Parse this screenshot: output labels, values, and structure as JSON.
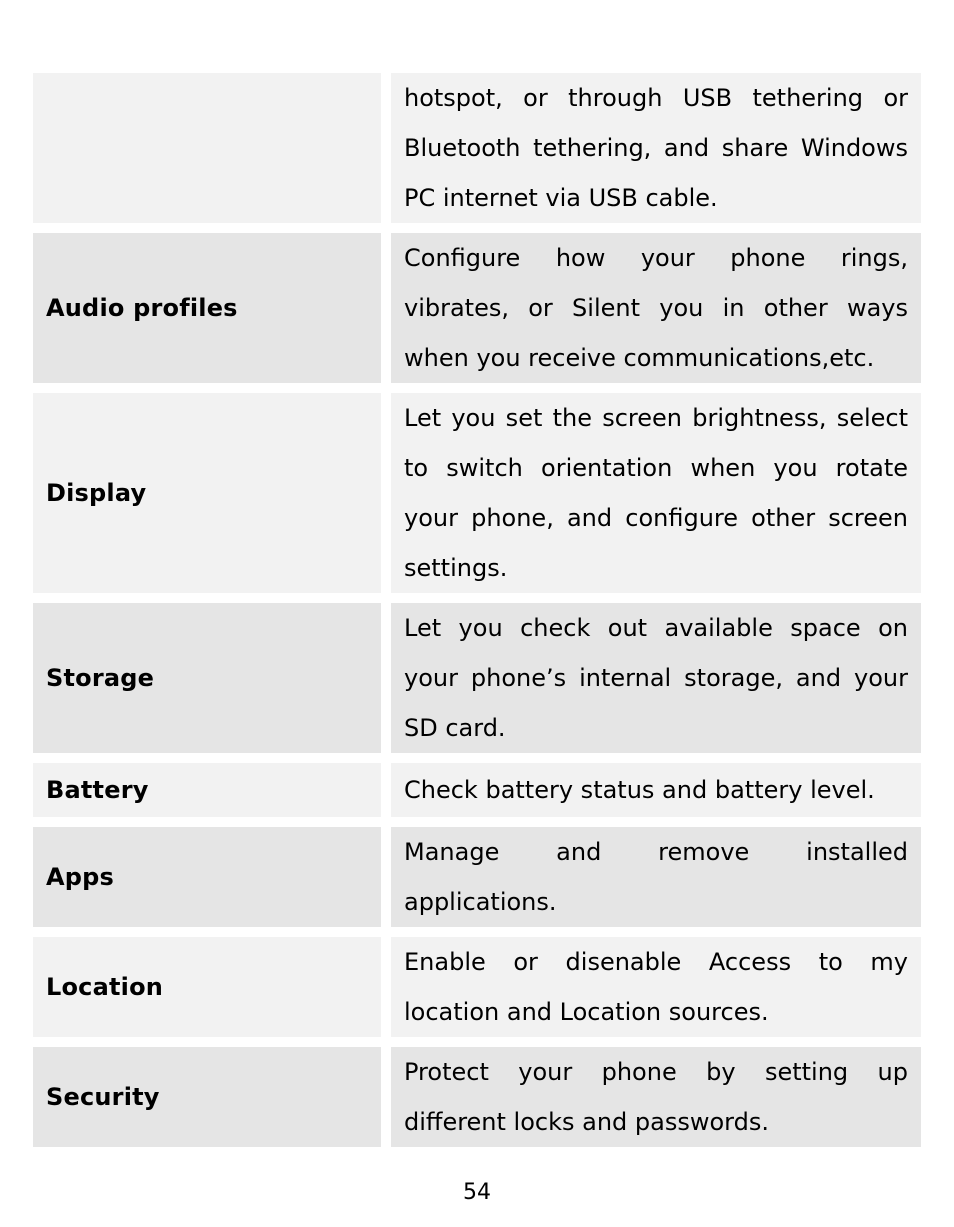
{
  "rows": [
    {
      "label": "",
      "description": "hotspot, or through USB tethering or Bluetooth tethering, and share Windows PC internet via USB cable.",
      "shade": "light"
    },
    {
      "label": "Audio profiles",
      "description": "Configure how your phone rings, vibrates, or Silent you in other ways when you receive communications,etc.",
      "shade": "dark"
    },
    {
      "label": "Display",
      "description": "Let you set the screen brightness, select to switch orientation when you rotate your phone, and configure other screen settings.",
      "shade": "light"
    },
    {
      "label": "Storage",
      "description": "Let you check out available space on your phone’s internal storage, and your SD card.",
      "shade": "dark"
    },
    {
      "label": "Battery",
      "description": "Check battery status and battery level.",
      "shade": "light"
    },
    {
      "label": "Apps",
      "description": "Manage and remove installed applications.",
      "shade": "dark"
    },
    {
      "label": "Location",
      "description": "Enable or disenable Access to my location and Location sources.",
      "shade": "light"
    },
    {
      "label": "Security",
      "description": "Protect your phone by setting up different locks and passwords.",
      "shade": "dark"
    }
  ],
  "page_number": "54",
  "colors": {
    "light_row": "#f2f2f2",
    "dark_row": "#e5e5e5"
  }
}
